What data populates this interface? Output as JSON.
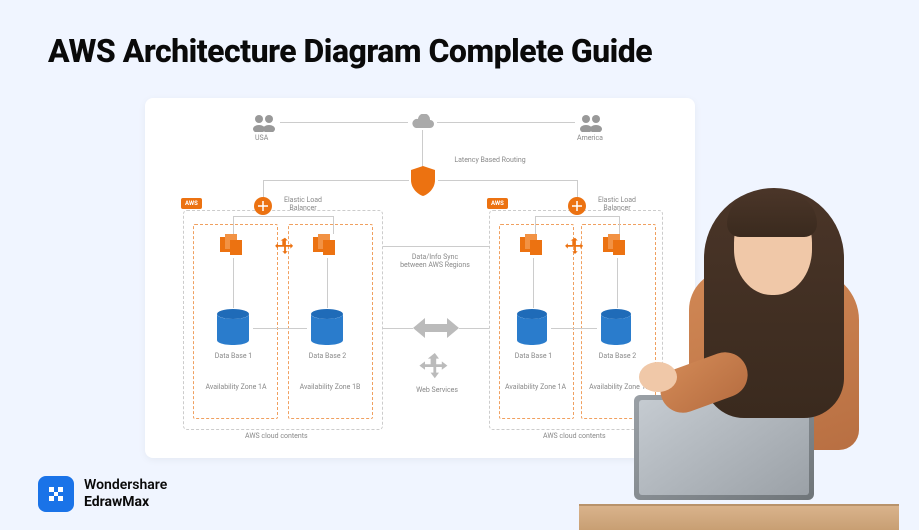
{
  "title": "AWS Architecture Diagram Complete Guide",
  "brand": {
    "line1": "Wondershare",
    "line2": "EdrawMax"
  },
  "diagram": {
    "users_left": "USA",
    "users_right": "America",
    "routing": "Latency Based Routing",
    "elb": "Elastic Load Balancer",
    "sync": "Data/Info Sync between AWS Regions",
    "webservices": "Web Services",
    "db1": "Data Base 1",
    "db2": "Data Base 2",
    "az1": "Availability Zone 1A",
    "az2": "Availability Zone 1B",
    "cloud_contents": "AWS cloud contents",
    "aws": "AWS"
  }
}
